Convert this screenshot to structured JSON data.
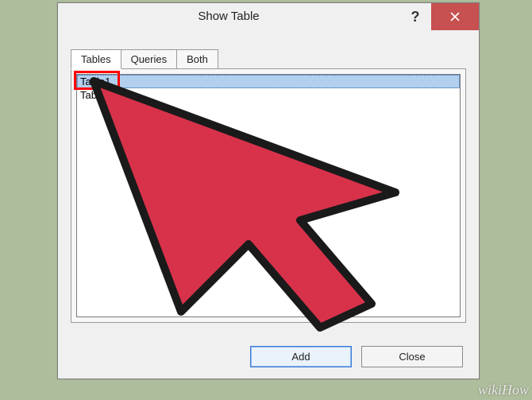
{
  "dialog": {
    "title": "Show Table"
  },
  "tabs": {
    "items": [
      {
        "label": "Tables",
        "active": true
      },
      {
        "label": "Queries",
        "active": false
      },
      {
        "label": "Both",
        "active": false
      }
    ]
  },
  "list": {
    "items": [
      {
        "label": "Table1",
        "selected": true
      },
      {
        "label": "Table2",
        "selected": false
      }
    ]
  },
  "buttons": {
    "add": "Add",
    "close": "Close"
  },
  "watermark": "wikiHow",
  "colors": {
    "close_bg": "#c75050",
    "arrow_fill": "#d8324b",
    "arrow_stroke": "#1a1a1a",
    "highlight": "#ff0000",
    "selection_bg": "#b3cfee"
  }
}
